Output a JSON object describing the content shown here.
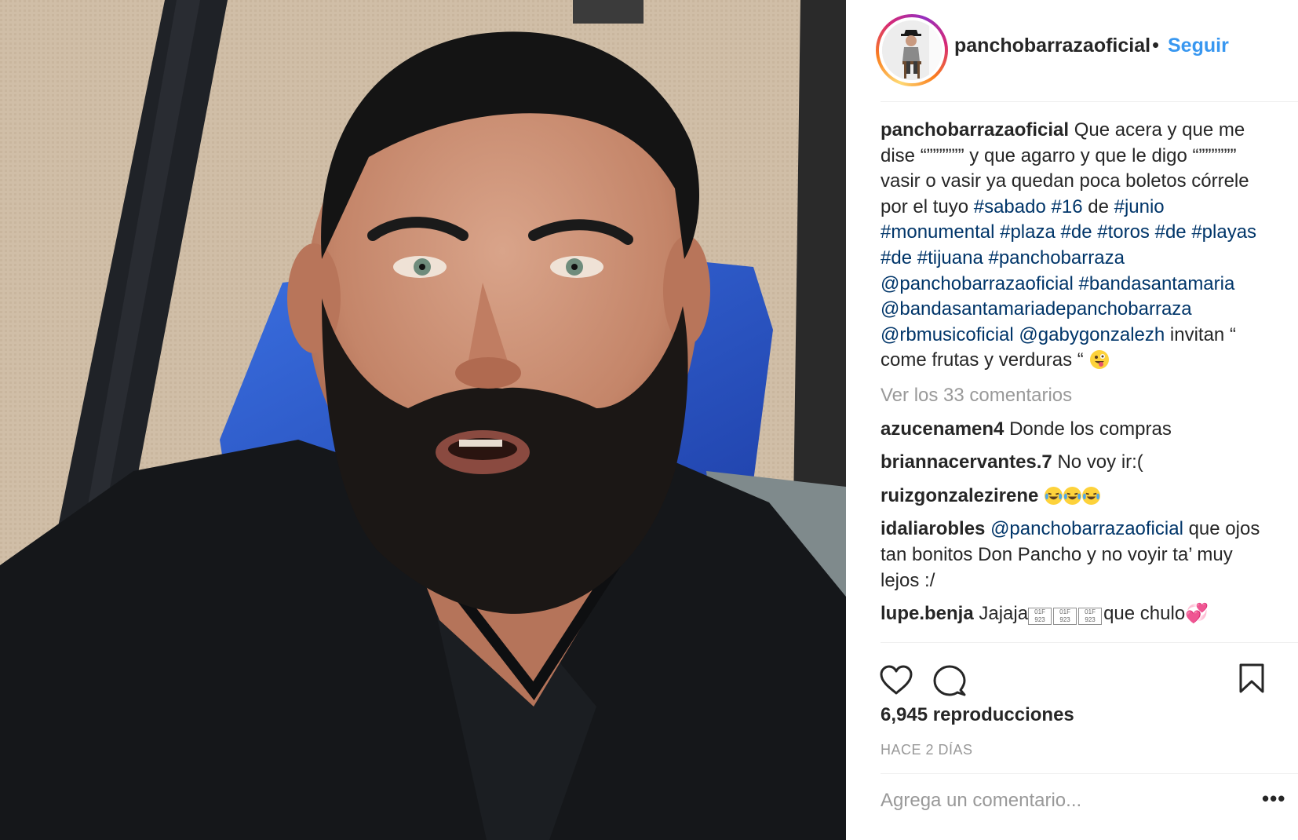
{
  "header": {
    "username": "panchobarrazaoficial",
    "dot": "•",
    "follow_label": "Seguir"
  },
  "caption": {
    "username": "panchobarrazaoficial",
    "text_1": "Que acera y que me dise “”””””” y que agarro y que le digo “”””””” vasir o vasir ya quedan poca boletos córrele por el tuyo ",
    "hashtags_1": [
      "#sabado",
      "#16"
    ],
    "text_2": "de",
    "hashtags_2": [
      "#junio",
      "#monumental",
      "#plaza",
      "#de",
      "#toros",
      "#de",
      "#playas",
      "#de",
      "#tijuana",
      "#panchobarraza",
      "@panchobarrazaoficial",
      "#bandasantamaria",
      "@bandasantamariadepanchobarraza",
      "@rbmusicoficial",
      "@gabygonzalezh"
    ],
    "text_3": " invitan “ come frutas y verduras “ ",
    "emoji": "zany-face-emoji"
  },
  "view_all_comments": "Ver los 33 comentarios",
  "comments": [
    {
      "user": "azucenamen4",
      "text": "Donde los compras"
    },
    {
      "user": "briannacervantes.7",
      "text": "No voy ir:("
    },
    {
      "user": "ruizgonzalezirene",
      "text": "",
      "emoji": "laughing-tears-emoji x3"
    },
    {
      "user": "idaliarobles",
      "mention": "@panchobarrazaoficial",
      "text": " que ojos tan bonitos Don Pancho y no voyir ta’ muy lejos :/"
    },
    {
      "user": "lupe.benja",
      "text_before": "Jajaja",
      "missing_glyphs": [
        "01F 923",
        "01F 923",
        "01F 923"
      ],
      "text_after": "que chulo",
      "emoji": "two-hearts-emoji"
    }
  ],
  "stats": {
    "plays": "6,945 reproducciones",
    "time": "HACE 2 DÍAS"
  },
  "add_comment": {
    "placeholder": "Agrega un comentario...",
    "more_label": "•••"
  },
  "icons": [
    "heart-icon",
    "comment-icon",
    "bookmark-icon"
  ],
  "colors": {
    "link": "#3897f0",
    "hashtag": "#003569",
    "muted": "#999999",
    "text": "#262626"
  }
}
